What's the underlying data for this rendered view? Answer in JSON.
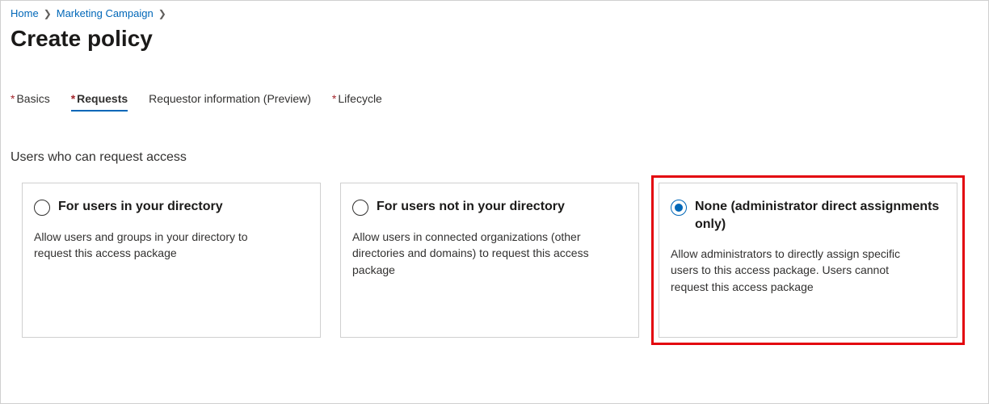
{
  "breadcrumb": {
    "items": [
      {
        "label": "Home"
      },
      {
        "label": "Marketing Campaign"
      }
    ]
  },
  "page_title": "Create policy",
  "tabs": [
    {
      "label": "Basics",
      "required": true,
      "active": false
    },
    {
      "label": "Requests",
      "required": true,
      "active": true
    },
    {
      "label": "Requestor information (Preview)",
      "required": false,
      "active": false
    },
    {
      "label": "Lifecycle",
      "required": true,
      "active": false
    }
  ],
  "section_heading": "Users who can request access",
  "options": [
    {
      "title": "For users in your directory",
      "description": "Allow users and groups in your directory to request this access package",
      "selected": false,
      "highlighted": false
    },
    {
      "title": "For users not in your directory",
      "description": "Allow users in connected organizations (other directories and domains) to request this access package",
      "selected": false,
      "highlighted": false
    },
    {
      "title": "None (administrator direct assignments only)",
      "description": "Allow administrators to directly assign specific users to this access package. Users cannot request this access package",
      "selected": true,
      "highlighted": true
    }
  ]
}
